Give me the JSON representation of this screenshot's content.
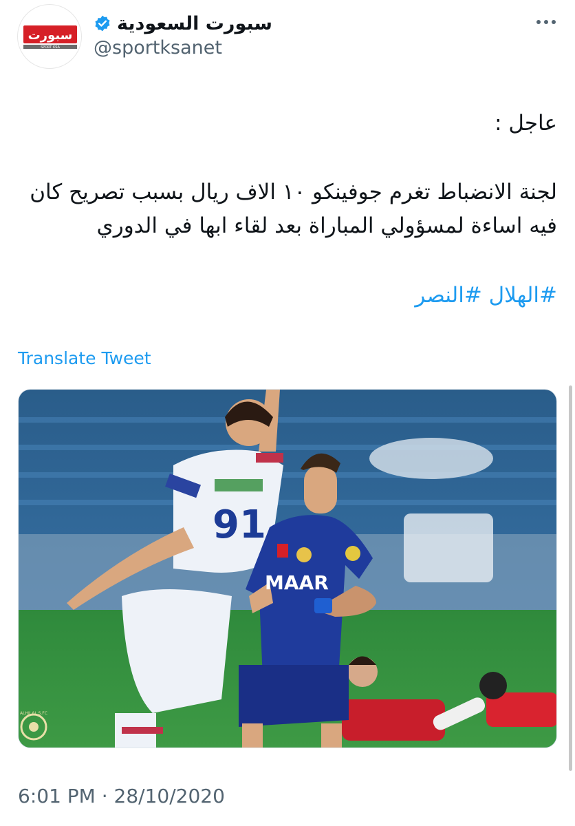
{
  "tweet": {
    "display_name": "سبورت السعودية",
    "handle": "@sportksanet",
    "avatar_logo_text": "سبورت",
    "avatar_logo_subtext": "SPORT KSA",
    "text_line_1": "عاجل :",
    "text_paragraph": "لجنة الانضباط تغرم جوفينكو ١٠ الاف ريال بسبب تصريح كان فيه اساءة لمسؤولي المباراة بعد لقاء ابها في الدوري",
    "hashtags": "#الهلال #النصر",
    "translate_label": "Translate Tweet",
    "timestamp": "6:01 PM · 28/10/2020",
    "media": {
      "jersey_number": "91",
      "sponsor_text": "MAAR",
      "club_badge_text": "ALHILAL S.FC",
      "description_icon": "football-photo"
    }
  },
  "colors": {
    "link": "#1d9bf0",
    "secondary_text": "#536471",
    "verified": "#1d9bf0",
    "hilal_blue": "#1f3b9c",
    "pitch_green": "#2f8a3c"
  },
  "icons": {
    "verified": "verified-badge-icon",
    "more": "more-dots-icon"
  }
}
